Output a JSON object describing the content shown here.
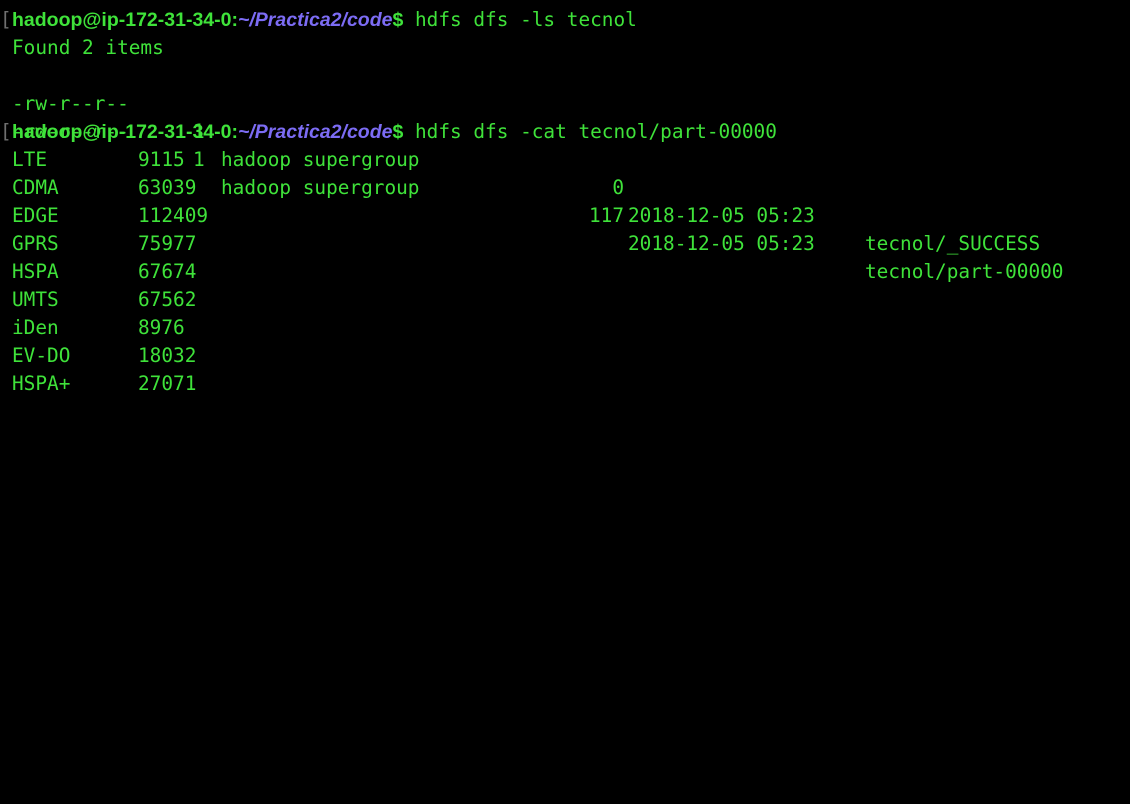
{
  "terminal": {
    "prompt": {
      "user_host": "hadoop@ip-172-31-34-0",
      "separator": ":",
      "path": "~/Practica2/code",
      "dollar": "$"
    },
    "commands": [
      "hdfs dfs -ls tecnol",
      "hdfs dfs -cat tecnol/part-00000"
    ],
    "ls_output": {
      "summary": "Found 2 items",
      "entries": [
        {
          "permissions": "-rw-r--r--",
          "replication": "1",
          "owner_group": "hadoop supergroup",
          "size": "0",
          "datetime": "2018-12-05 05:23",
          "name": "tecnol/_SUCCESS"
        },
        {
          "permissions": "-rw-r--r--",
          "replication": "1",
          "owner_group": "hadoop supergroup",
          "size": "117",
          "datetime": "2018-12-05 05:23",
          "name": "tecnol/part-00000"
        }
      ]
    },
    "cat_output": [
      {
        "key": "LTE",
        "value": "9115"
      },
      {
        "key": "CDMA",
        "value": "63039"
      },
      {
        "key": "EDGE",
        "value": "112409"
      },
      {
        "key": "GPRS",
        "value": "75977"
      },
      {
        "key": "HSPA",
        "value": "67674"
      },
      {
        "key": "UMTS",
        "value": "67562"
      },
      {
        "key": "iDen",
        "value": "8976"
      },
      {
        "key": "EV-DO",
        "value": "18032"
      },
      {
        "key": "HSPA+",
        "value": "27071"
      }
    ],
    "colors": {
      "background": "#000000",
      "text": "#3fe23a",
      "path": "#7c6cf4"
    }
  }
}
